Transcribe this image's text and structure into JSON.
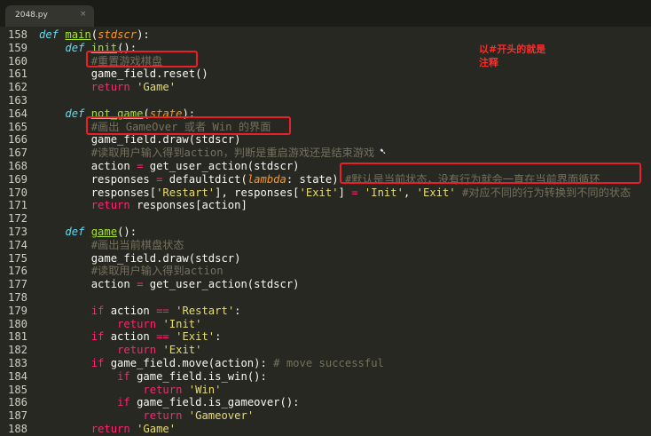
{
  "tab": {
    "title": "2048.py",
    "close_glyph": "×"
  },
  "annotation": {
    "line1": "以#开头的就是",
    "line2": "注释"
  },
  "lines": [
    {
      "num": "158",
      "parts": [
        [
          "k",
          "def "
        ],
        [
          "n",
          "main"
        ],
        [
          "",
          "("
        ],
        [
          "p",
          "stdscr"
        ],
        [
          "",
          "):"
        ]
      ]
    },
    {
      "num": "159",
      "parts": [
        [
          "",
          "    "
        ],
        [
          "k",
          "def "
        ],
        [
          "n",
          "init"
        ],
        [
          "",
          "():"
        ]
      ]
    },
    {
      "num": "160",
      "parts": [
        [
          "",
          "        "
        ],
        [
          "c",
          "#重置游戏棋盘"
        ]
      ]
    },
    {
      "num": "161",
      "parts": [
        [
          "",
          "        game_field.reset()"
        ]
      ]
    },
    {
      "num": "162",
      "parts": [
        [
          "",
          "        "
        ],
        [
          "o",
          "return "
        ],
        [
          "s",
          "'Game'"
        ]
      ]
    },
    {
      "num": "163",
      "parts": [
        [
          "",
          ""
        ]
      ]
    },
    {
      "num": "164",
      "parts": [
        [
          "",
          "    "
        ],
        [
          "k",
          "def "
        ],
        [
          "n",
          "not_game"
        ],
        [
          "",
          "("
        ],
        [
          "p",
          "state"
        ],
        [
          "",
          "):"
        ]
      ]
    },
    {
      "num": "165",
      "parts": [
        [
          "",
          "        "
        ],
        [
          "c",
          "#画出 GameOver 或者 Win 的界面"
        ]
      ]
    },
    {
      "num": "166",
      "parts": [
        [
          "",
          "        game_field.draw(stdscr)"
        ]
      ]
    },
    {
      "num": "167",
      "parts": [
        [
          "",
          "        "
        ],
        [
          "c",
          "#读取用户输入得到action，判断是重启游戏还是结束游戏"
        ]
      ]
    },
    {
      "num": "168",
      "parts": [
        [
          "",
          "        action "
        ],
        [
          "o",
          "="
        ],
        [
          "",
          " get_user_action(stdscr)"
        ]
      ]
    },
    {
      "num": "169",
      "parts": [
        [
          "",
          "        responses "
        ],
        [
          "o",
          "="
        ],
        [
          "",
          " defaultdict("
        ],
        [
          "p",
          "lambda"
        ],
        [
          "",
          ": state) "
        ],
        [
          "c",
          "#默认是当前状态，没有行为就会一直在当前界面循环"
        ]
      ]
    },
    {
      "num": "170",
      "parts": [
        [
          "",
          "        responses["
        ],
        [
          "s",
          "'Restart'"
        ],
        [
          "",
          "], responses["
        ],
        [
          "s",
          "'Exit'"
        ],
        [
          "",
          "] "
        ],
        [
          "o",
          "="
        ],
        [
          "",
          " "
        ],
        [
          "s",
          "'Init'"
        ],
        [
          "",
          ", "
        ],
        [
          "s",
          "'Exit'"
        ],
        [
          "",
          " "
        ],
        [
          "c",
          "#对应不同的行为转换到不同的状态"
        ]
      ]
    },
    {
      "num": "171",
      "parts": [
        [
          "",
          "        "
        ],
        [
          "o",
          "return "
        ],
        [
          "",
          "responses[action]"
        ]
      ]
    },
    {
      "num": "172",
      "parts": [
        [
          "",
          ""
        ]
      ]
    },
    {
      "num": "173",
      "parts": [
        [
          "",
          "    "
        ],
        [
          "k",
          "def "
        ],
        [
          "n",
          "game"
        ],
        [
          "",
          "():"
        ]
      ]
    },
    {
      "num": "174",
      "parts": [
        [
          "",
          "        "
        ],
        [
          "c",
          "#画出当前棋盘状态"
        ]
      ]
    },
    {
      "num": "175",
      "parts": [
        [
          "",
          "        game_field.draw(stdscr)"
        ]
      ]
    },
    {
      "num": "176",
      "parts": [
        [
          "",
          "        "
        ],
        [
          "c",
          "#读取用户输入得到action"
        ]
      ]
    },
    {
      "num": "177",
      "parts": [
        [
          "",
          "        action "
        ],
        [
          "o",
          "="
        ],
        [
          "",
          " get_user_action(stdscr)"
        ]
      ]
    },
    {
      "num": "178",
      "parts": [
        [
          "",
          ""
        ]
      ]
    },
    {
      "num": "179",
      "parts": [
        [
          "",
          "        "
        ],
        [
          "o",
          "if "
        ],
        [
          "",
          "action "
        ],
        [
          "o",
          "=="
        ],
        [
          "",
          " "
        ],
        [
          "s",
          "'Restart'"
        ],
        [
          "",
          ":"
        ]
      ]
    },
    {
      "num": "180",
      "parts": [
        [
          "",
          "            "
        ],
        [
          "o",
          "return "
        ],
        [
          "s",
          "'Init'"
        ]
      ]
    },
    {
      "num": "181",
      "parts": [
        [
          "",
          "        "
        ],
        [
          "o",
          "if "
        ],
        [
          "",
          "action "
        ],
        [
          "o",
          "=="
        ],
        [
          "",
          " "
        ],
        [
          "s",
          "'Exit'"
        ],
        [
          "",
          ":"
        ]
      ]
    },
    {
      "num": "182",
      "parts": [
        [
          "",
          "            "
        ],
        [
          "o",
          "return "
        ],
        [
          "s",
          "'Exit'"
        ]
      ]
    },
    {
      "num": "183",
      "parts": [
        [
          "",
          "        "
        ],
        [
          "o",
          "if "
        ],
        [
          "",
          "game_field.move(action): "
        ],
        [
          "c",
          "# move successful"
        ]
      ]
    },
    {
      "num": "184",
      "parts": [
        [
          "",
          "            "
        ],
        [
          "o",
          "if "
        ],
        [
          "",
          "game_field.is_win():"
        ]
      ]
    },
    {
      "num": "185",
      "parts": [
        [
          "",
          "                "
        ],
        [
          "o",
          "return "
        ],
        [
          "s",
          "'Win'"
        ]
      ]
    },
    {
      "num": "186",
      "parts": [
        [
          "",
          "            "
        ],
        [
          "o",
          "if "
        ],
        [
          "",
          "game_field.is_gameover():"
        ]
      ]
    },
    {
      "num": "187",
      "parts": [
        [
          "",
          "                "
        ],
        [
          "o",
          "return "
        ],
        [
          "s",
          "'Gameover'"
        ]
      ]
    },
    {
      "num": "188",
      "parts": [
        [
          "",
          "        "
        ],
        [
          "o",
          "return "
        ],
        [
          "s",
          "'Game'"
        ]
      ]
    }
  ]
}
